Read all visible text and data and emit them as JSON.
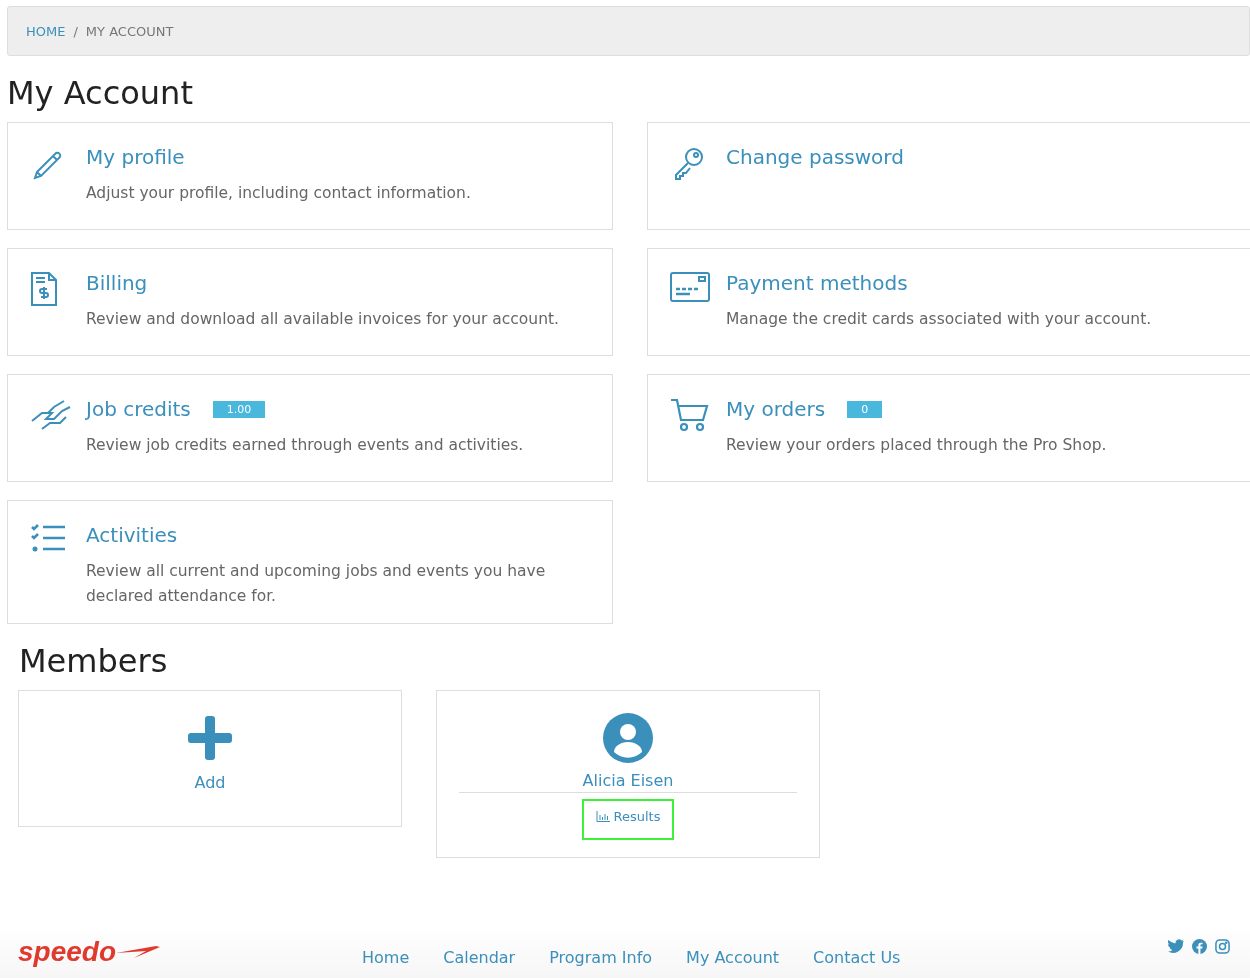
{
  "breadcrumb": [
    {
      "label": "HOME",
      "kind": "link"
    },
    {
      "label": "/",
      "kind": "separator"
    },
    {
      "label": "MY ACCOUNT",
      "kind": "current"
    }
  ],
  "title": "My Account",
  "cards": [
    {
      "kind": "pencil",
      "title": "My profile",
      "description": "Adjust your profile, including contact information."
    },
    {
      "kind": "key",
      "title": "Change password"
    },
    {
      "kind": "invoice",
      "title": "Billing",
      "description": "Review and download all available invoices for your account."
    },
    {
      "kind": "card",
      "title": "Payment methods",
      "description": "Manage the credit cards associated with your account."
    },
    {
      "kind": "handshake",
      "title": "Job credits",
      "badge": "1.00",
      "description": "Review job credits earned through events and activities."
    },
    {
      "kind": "cart",
      "title": "My orders",
      "badge": "0",
      "description": "Review your orders placed through the Pro Shop."
    },
    {
      "kind": "checklist",
      "title": "Activities",
      "description": "Review all current and upcoming jobs and events you have declared attendance for."
    }
  ],
  "members_title": "Members",
  "add_label": "Add",
  "members": [
    {
      "name": "Alicia Eisen",
      "link": "Results",
      "focused": true
    }
  ],
  "footer": {
    "logo": "speedo",
    "links": [
      "Home",
      "Calendar",
      "Program Info",
      "My Account",
      "Contact Us"
    ]
  }
}
